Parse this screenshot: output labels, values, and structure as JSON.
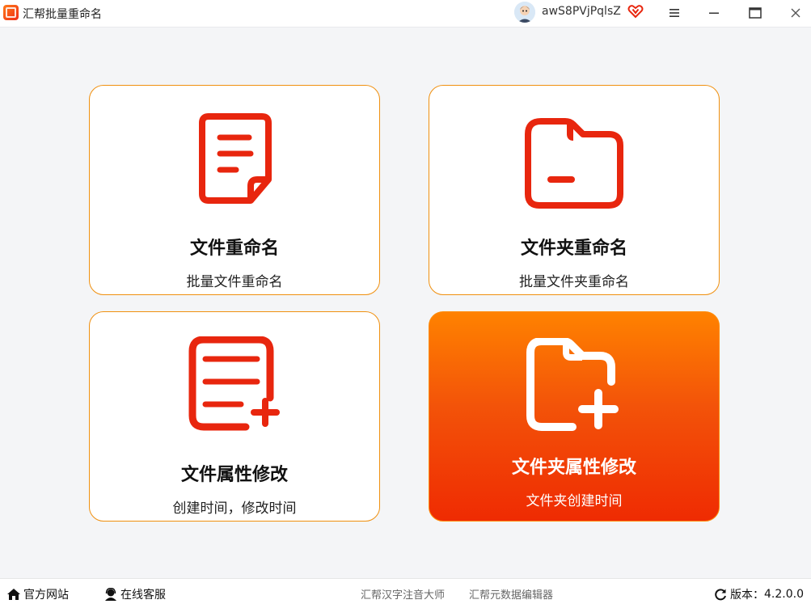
{
  "app": {
    "title": "汇帮批量重命名"
  },
  "user": {
    "name": "awS8PVjPqlsZ"
  },
  "cards": [
    {
      "title": "文件重命名",
      "subtitle": "批量文件重命名",
      "icon": "document-icon"
    },
    {
      "title": "文件夹重命名",
      "subtitle": "批量文件夹重命名",
      "icon": "folder-icon"
    },
    {
      "title": "文件属性修改",
      "subtitle": "创建时间，修改时间",
      "icon": "document-add-icon"
    },
    {
      "title": "文件夹属性修改",
      "subtitle": "文件夹创建时间",
      "icon": "folder-add-icon",
      "active": true
    }
  ],
  "footer": {
    "official_site": "官方网站",
    "online_service": "在线客服",
    "link1": "汇帮汉字注音大师",
    "link2": "汇帮元数据编辑器",
    "version_label": "版本：",
    "version": "4.2.0.0"
  },
  "colors": {
    "accent": "#f0900f",
    "icon_red": "#e8260e",
    "active_top": "#ff8200",
    "active_bottom": "#ef2b02"
  }
}
